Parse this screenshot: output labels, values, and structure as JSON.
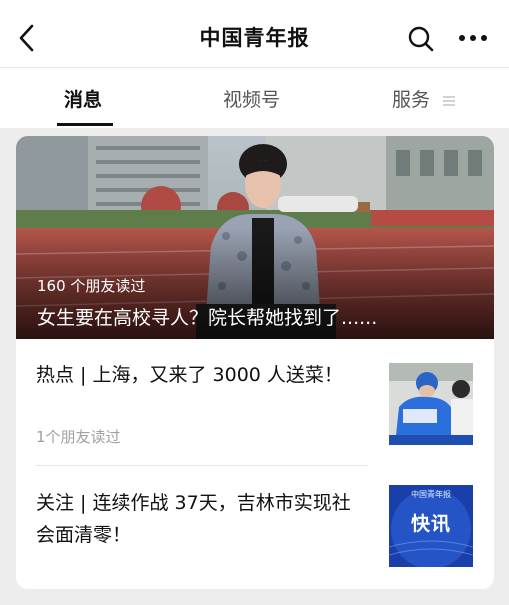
{
  "header": {
    "title": "中国青年报",
    "back_icon": "chevron-left-icon",
    "search_icon": "search-icon",
    "more_icon": "more-dots-icon"
  },
  "tabs": [
    {
      "label": "消息",
      "active": true
    },
    {
      "label": "视频号",
      "active": false
    },
    {
      "label": "服务",
      "active": false,
      "icon": "menu-lines-icon"
    }
  ],
  "articles": {
    "featured": {
      "reads": "160 个朋友读过",
      "title": "女生要在高校寻人？院长帮她找到了......"
    },
    "items": [
      {
        "title": "热点 | 上海，又来了 3000 人送菜！",
        "reads": "1个朋友读过",
        "thumb": "delivery-worker-photo"
      },
      {
        "title": "关注 | 连续作战 37天，吉林市实现社会面清零！",
        "thumb_text": "快讯",
        "thumb_brand": "中国青年报"
      }
    ]
  },
  "colors": {
    "background": "#ededed",
    "card": "#ffffff",
    "thumb_blue": "#1f5fd6"
  }
}
